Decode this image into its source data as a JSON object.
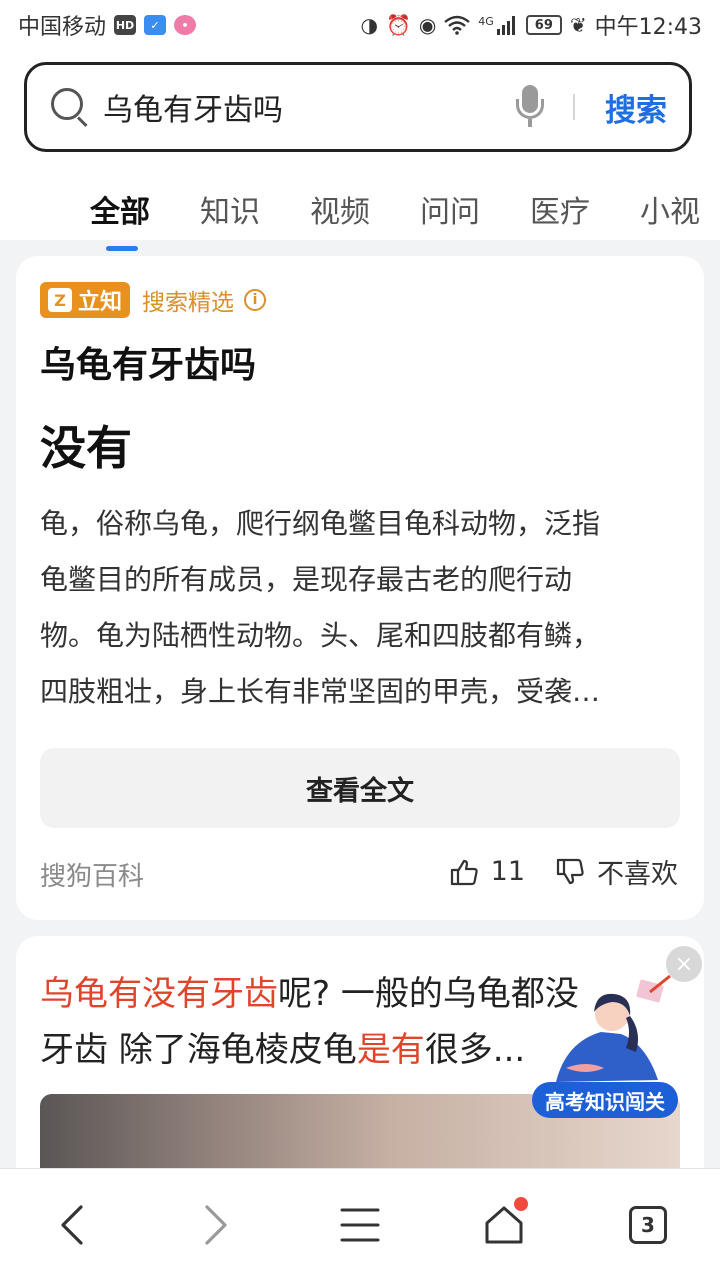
{
  "status_bar": {
    "carrier": "中国移动",
    "hd_badge": "HD",
    "battery": "69",
    "time": "中午12:43",
    "network": "4G",
    "icons": [
      "hd-icon",
      "shield-icon",
      "app-icon",
      "data-saver-icon",
      "alarm-icon",
      "eye-icon",
      "wifi-icon",
      "signal-icon",
      "battery-icon",
      "leaf-icon"
    ]
  },
  "search": {
    "query": "乌龟有牙齿吗",
    "button_label": "搜索"
  },
  "tabs": [
    {
      "label": "全部",
      "active": true
    },
    {
      "label": "知识",
      "active": false
    },
    {
      "label": "视频",
      "active": false
    },
    {
      "label": "问问",
      "active": false
    },
    {
      "label": "医疗",
      "active": false
    },
    {
      "label": "小视",
      "active": false
    }
  ],
  "answer_card": {
    "brand_name": "立知",
    "brand_tag": "搜索精选",
    "title": "乌龟有牙齿吗",
    "answer": "没有",
    "body_lines": [
      "龟，俗称乌龟，爬行纲龟鳖目龟科动物，泛指",
      "龟鳖目的所有成员，是现存最古老的爬行动",
      "物。龟为陆栖性动物。头、尾和四肢都有鳞，",
      "四肢粗壮，身上长有非常坚固的甲壳，受袭…"
    ],
    "read_more_label": "查看全文",
    "source": "搜狗百科",
    "like_count": "11",
    "dislike_label": "不喜欢"
  },
  "result_card": {
    "line1": {
      "highlight": "乌龟有没有牙齿",
      "rest": "呢? 一般的乌龟都没"
    },
    "line2": {
      "pre": "牙齿 除了海龟棱皮龟",
      "highlight": "是有",
      "rest": "很多..."
    }
  },
  "promo": {
    "label": "高考知识闯关",
    "close": "×"
  },
  "bottom_nav": {
    "tabs_count": "3"
  },
  "colors": {
    "accent": "#1f6fe0",
    "highlight": "#e0452c",
    "brand_orange": "#e8911e",
    "notification": "#f04a3e"
  }
}
